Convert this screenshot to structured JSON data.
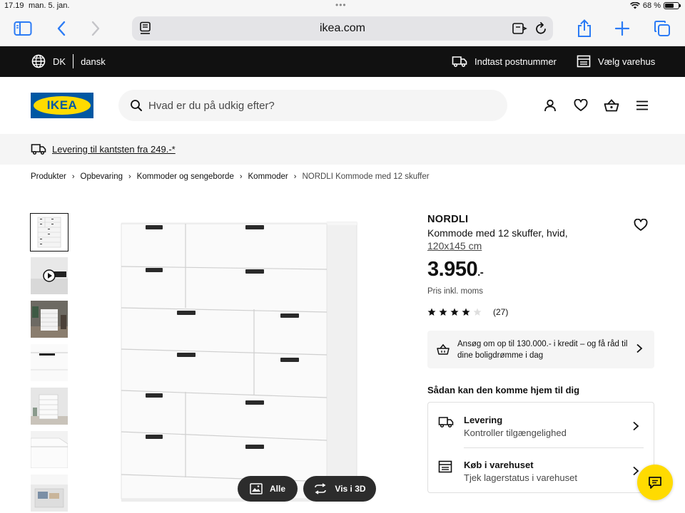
{
  "status_bar": {
    "time": "17.19",
    "date": "man. 5. jan.",
    "battery": "68 %"
  },
  "browser": {
    "url": "ikea.com"
  },
  "topbar": {
    "country": "DK",
    "language": "dansk",
    "postal": "Indtast postnummer",
    "store": "Vælg varehus"
  },
  "header": {
    "logo_text": "IKEA",
    "search_placeholder": "Hvad er du på udkig efter?"
  },
  "banner": {
    "text": "Levering til kantsten fra 249.-*"
  },
  "breadcrumb": [
    "Produkter",
    "Opbevaring",
    "Kommoder og sengeborde",
    "Kommoder",
    "NORDLI Kommode med 12 skuffer"
  ],
  "product": {
    "name": "NORDLI",
    "description": "Kommode med 12 skuffer, hvid,",
    "dimensions": "120x145 cm",
    "price_main": "3.950",
    "price_suffix": ".-",
    "price_note": "Pris inkl. moms",
    "rating": 4,
    "rating_max": 5,
    "review_count": "(27)"
  },
  "credit_box": {
    "text": "Ansøg om op til 130.000.- i kredit – og få råd til dine boligdrømme i dag"
  },
  "delivery_section": {
    "title": "Sådan kan den komme hjem til dig",
    "rows": [
      {
        "title": "Levering",
        "subtitle": "Kontroller tilgængelighed",
        "icon": "truck-icon"
      },
      {
        "title": "Køb i varehuset",
        "subtitle": "Tjek lagerstatus i varehuset",
        "icon": "store-icon"
      }
    ]
  },
  "image_actions": {
    "all": "Alle",
    "view3d": "Vis i 3D"
  },
  "colors": {
    "ikea_blue": "#0058a3",
    "ikea_yellow": "#ffdb00",
    "topbar": "#111111",
    "safari_blue": "#2b7bf5"
  }
}
